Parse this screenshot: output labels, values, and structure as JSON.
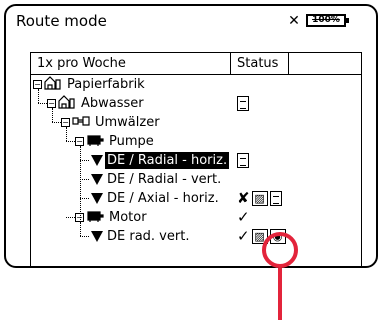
{
  "window": {
    "title": "Route mode"
  },
  "icons": {
    "bluetooth": "bluetooth-off-icon",
    "battery": "battery-icon"
  },
  "battery": {
    "label": "100%"
  },
  "table": {
    "columns": [
      "1x pro Woche",
      "Status"
    ],
    "rows": [
      {
        "label": "Papierfabrik",
        "level": 0,
        "icon": "factory-icon",
        "expander": "-",
        "status": []
      },
      {
        "label": "Abwasser",
        "level": 1,
        "icon": "factory-icon",
        "expander": "-",
        "status": [
          "document-icon"
        ]
      },
      {
        "label": "Umwälzer",
        "level": 2,
        "icon": "machine-icon",
        "expander": "-",
        "status": []
      },
      {
        "label": "Pumpe",
        "level": 3,
        "icon": "pump-icon",
        "expander": "-",
        "status": []
      },
      {
        "label": "DE / Radial - horiz.",
        "level": 4,
        "icon": "measurement-point-icon",
        "selected": true,
        "status": [
          "document-icon"
        ]
      },
      {
        "label": "DE / Radial - vert.",
        "level": 4,
        "icon": "measurement-point-icon",
        "status": []
      },
      {
        "label": "DE / Axial - horiz.",
        "level": 4,
        "icon": "measurement-point-icon",
        "status": [
          "skipped-icon",
          "spectrum-icon",
          "document-icon"
        ]
      },
      {
        "label": "Motor",
        "level": 3,
        "icon": "motor-icon",
        "expander": "-",
        "status": [
          "checkmark-icon"
        ]
      },
      {
        "label": "DE rad. vert.",
        "level": 4,
        "icon": "measurement-point-icon",
        "status": [
          "checkmark-icon",
          "spectrum-icon",
          "recording-icon"
        ]
      }
    ]
  },
  "colors": {
    "highlight": "#e3243b"
  }
}
